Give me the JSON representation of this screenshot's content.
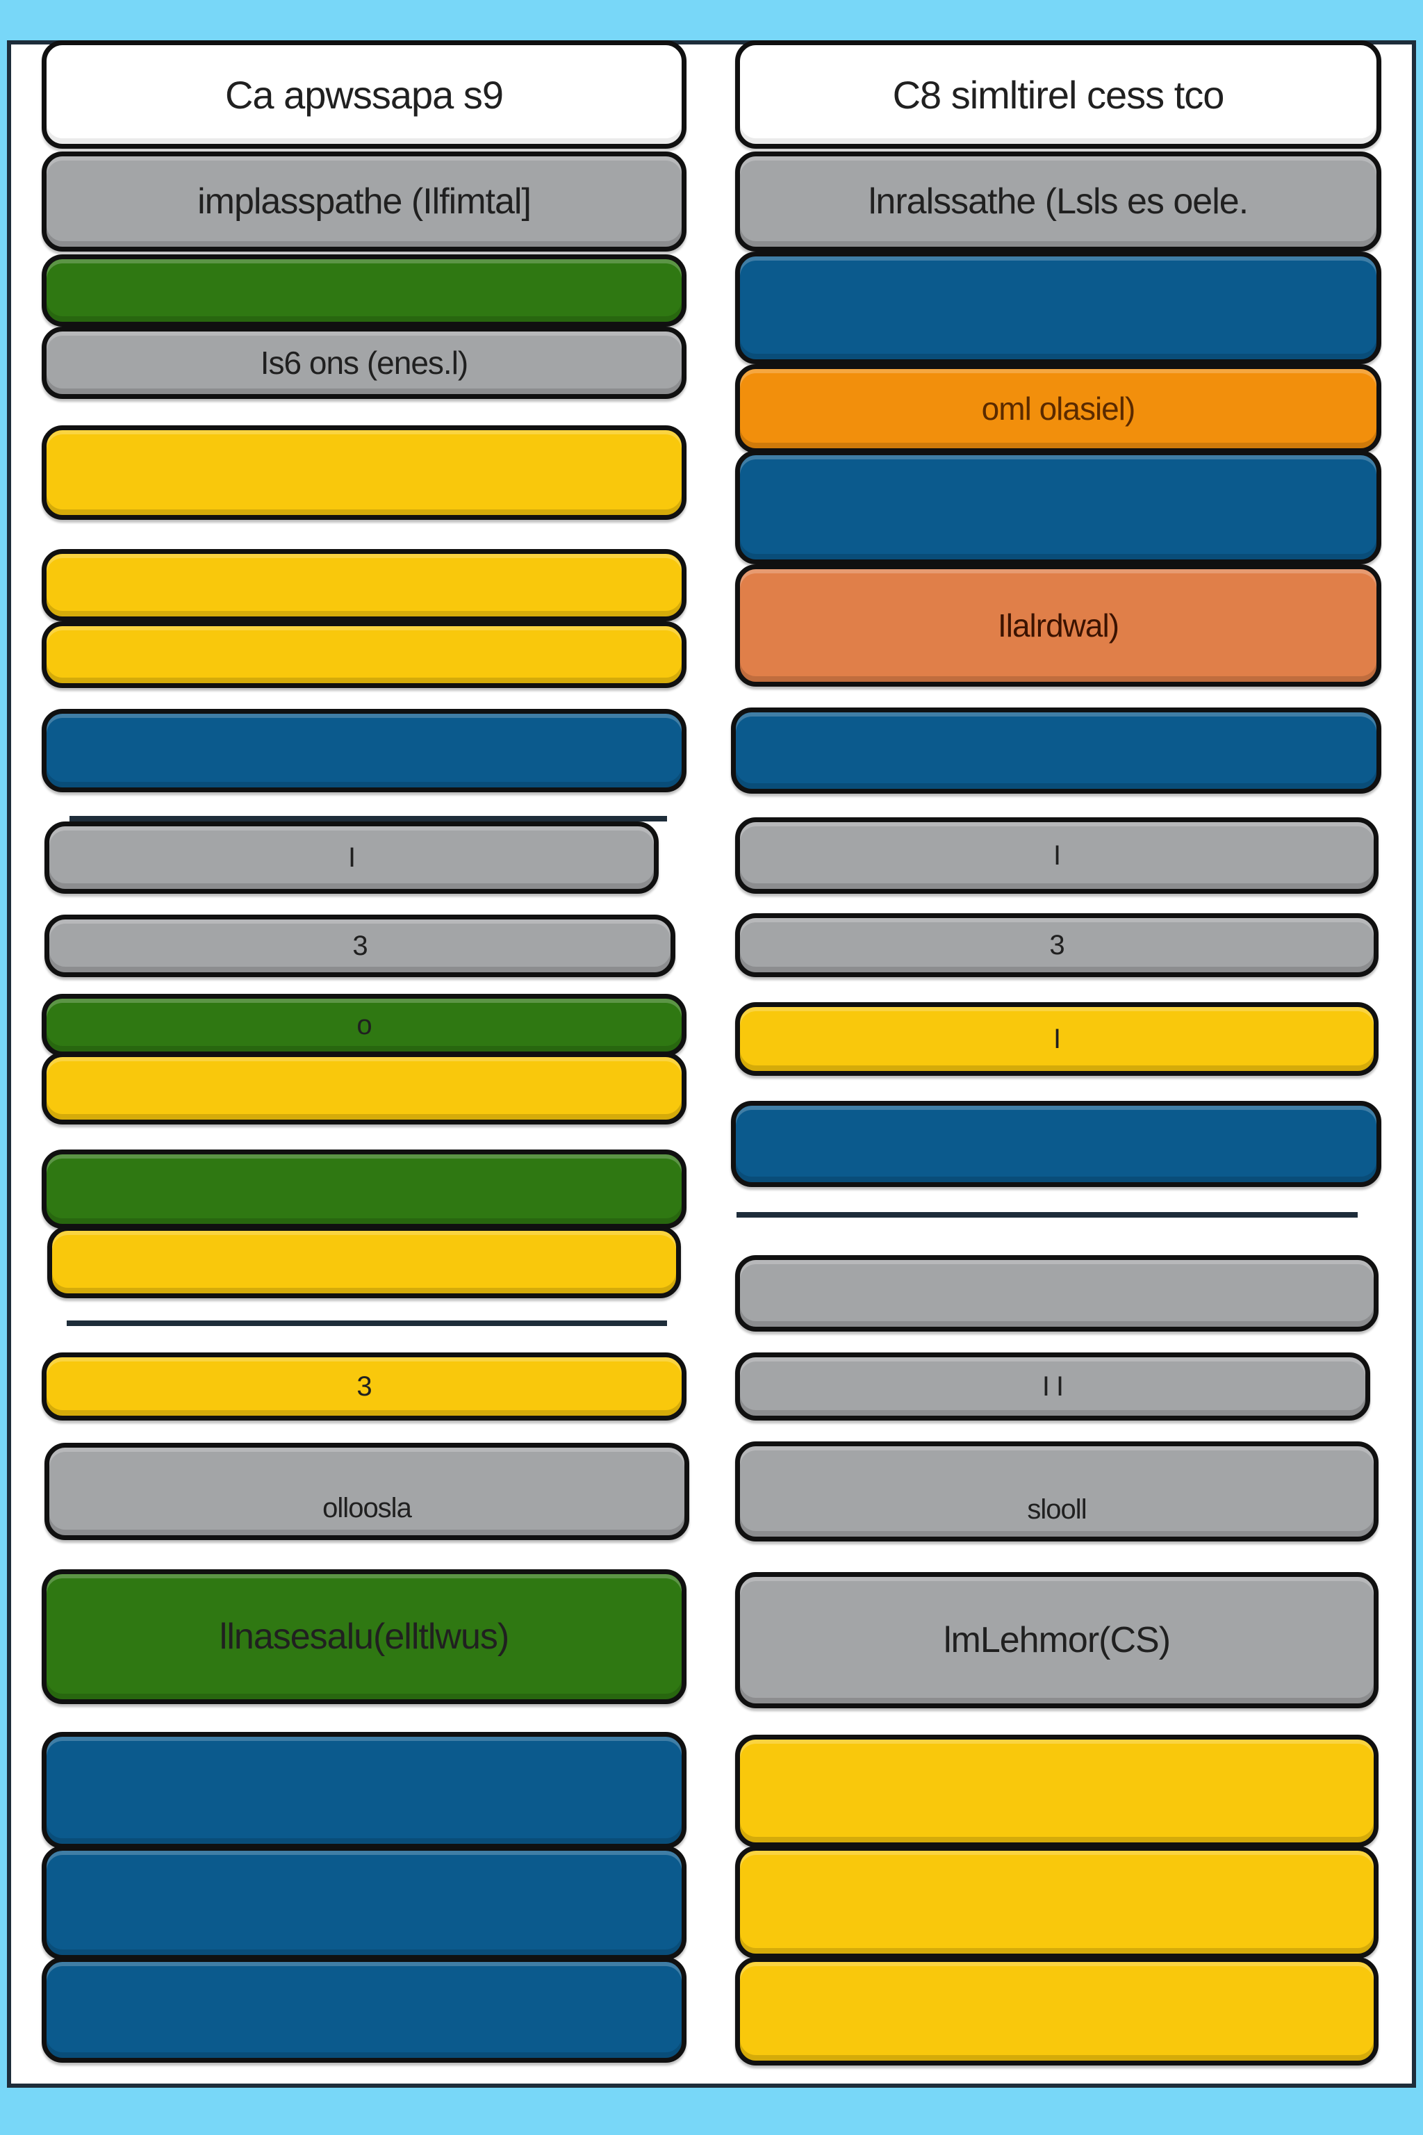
{
  "colors": {
    "background": "#78d7f8",
    "panel": "#ffffff",
    "outline": "#101010",
    "white": "#ffffff",
    "gray": "#a3a5a7",
    "green": "#2f7812",
    "yellow": "#f9c80c",
    "blue": "#0b5a8d",
    "orange": "#f28f0c",
    "salmon": "#e07f49"
  },
  "left_column": {
    "header": "Ca apwssapa s9",
    "subheader": "implasspathe (Ilfimtal]",
    "bar_gray_1": "Is6 ons (enes.l)",
    "bar_gray_2": "I",
    "bar_gray_3": "3",
    "bar_green_1": "o",
    "bar_yellow_1": "3",
    "bar_gray_4": "olloosla",
    "bar_green_2": "llnasesalu(elltlwus)"
  },
  "right_column": {
    "header": "C8 simltirel cess tco",
    "subheader": "lnralssathe (Lsls es oele.",
    "bar_orange": "oml olasiel)",
    "bar_salmon": "Ilalrdwal)",
    "bar_gray_1": "I",
    "bar_gray_2": "3",
    "bar_yellow_1": "I",
    "bar_gray_4": "I I",
    "bar_gray_5": "slooll",
    "bar_gray_6": "lmLehmor(CS)"
  }
}
